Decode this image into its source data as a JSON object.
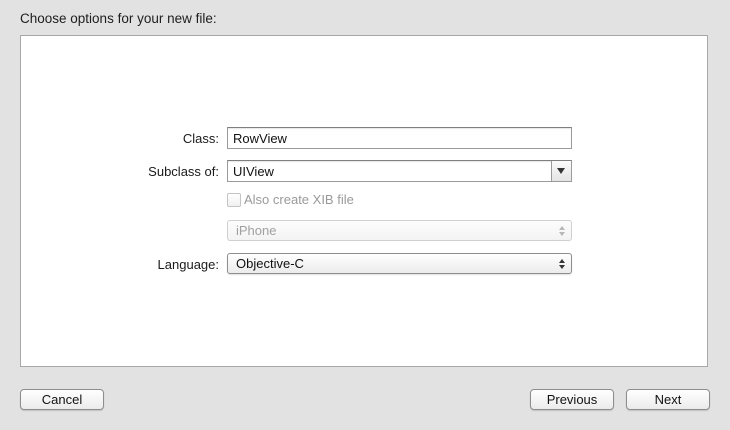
{
  "dialog": {
    "heading": "Choose options for your new file:"
  },
  "form": {
    "class_label": "Class:",
    "class_value": "RowView",
    "subclass_label": "Subclass of:",
    "subclass_value": "UIView",
    "xib_checkbox_label": "Also create XIB file",
    "xib_checked": false,
    "device_value": "iPhone",
    "language_label": "Language:",
    "language_value": "Objective-C"
  },
  "buttons": {
    "cancel": "Cancel",
    "previous": "Previous",
    "next": "Next"
  }
}
